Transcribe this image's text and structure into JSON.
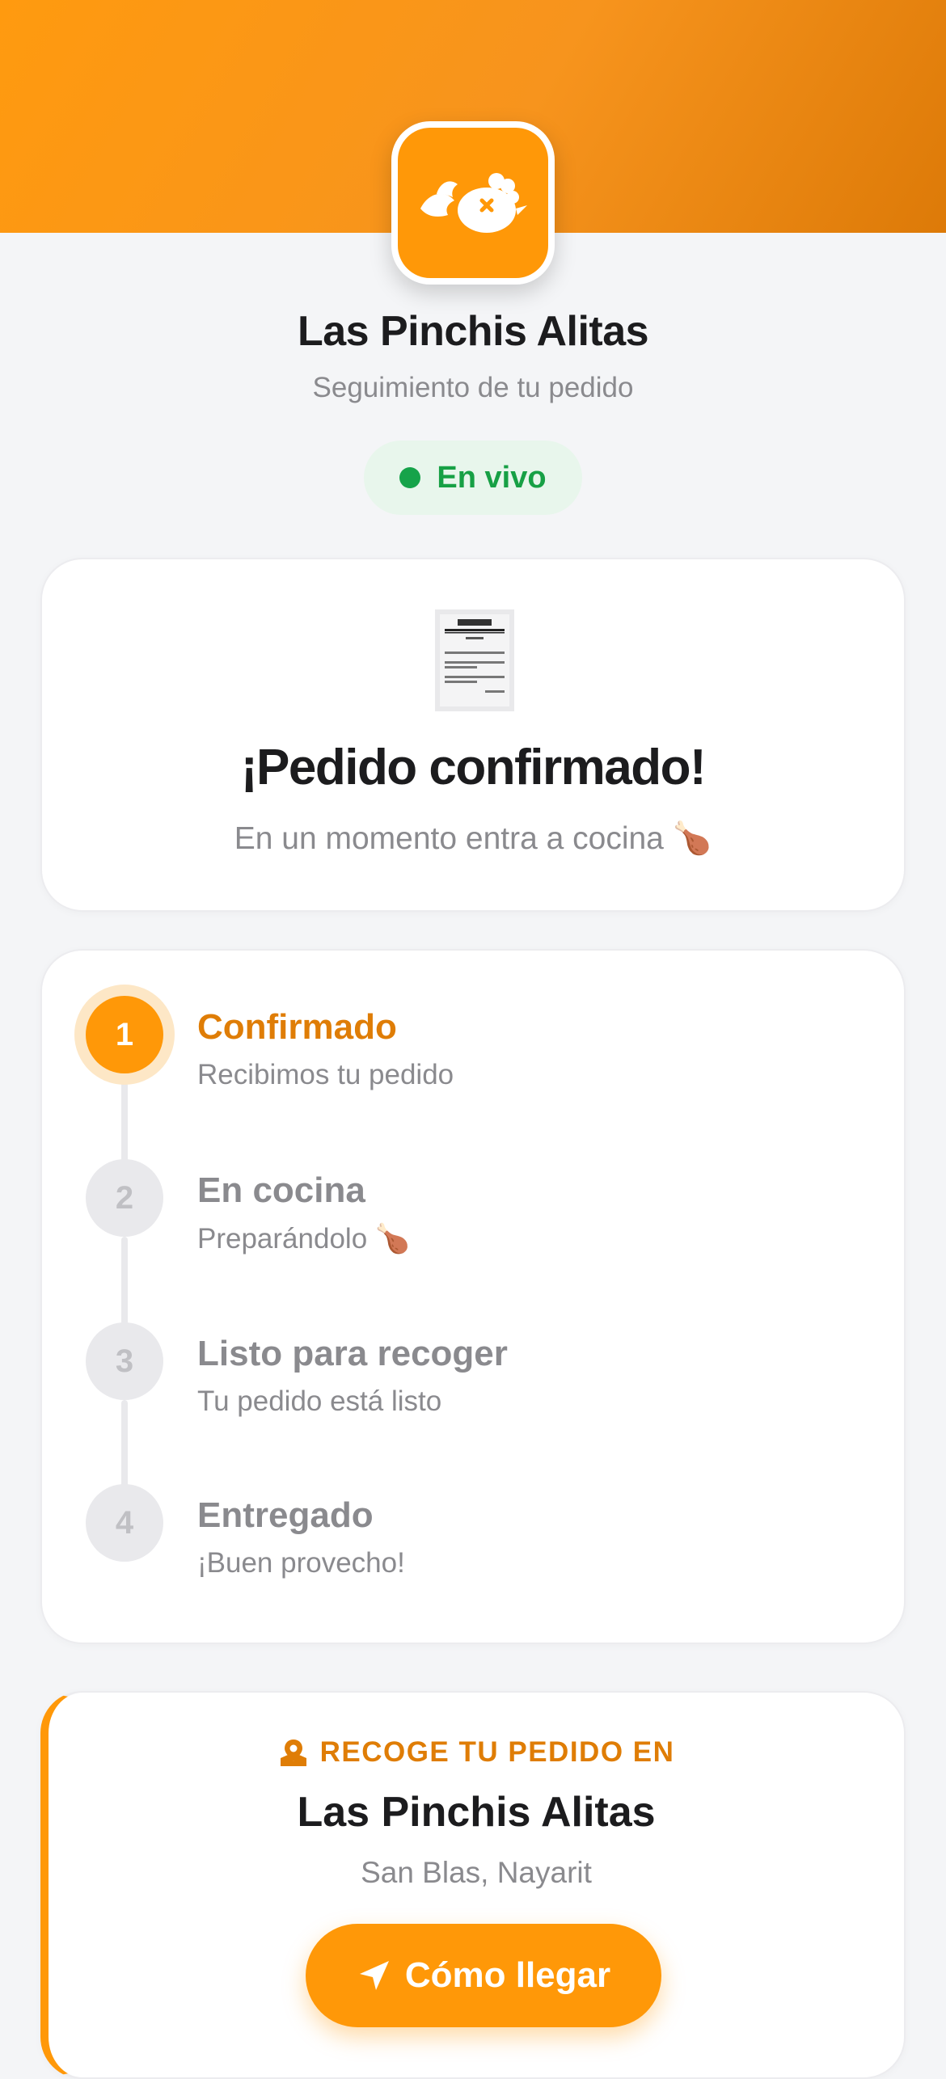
{
  "brand": {
    "name": "Las Pinchis Alitas",
    "subtitle": "Seguimiento de tu pedido",
    "logo_icon": "chicken-logo-icon",
    "accent_color": "#ff9808"
  },
  "live": {
    "label": "En vivo",
    "color": "#16a34a"
  },
  "confirmation": {
    "icon": "receipt-icon",
    "title": "¡Pedido confirmado!",
    "subtitle": "En un momento entra a cocina 🍗"
  },
  "steps": [
    {
      "number": "1",
      "title": "Confirmado",
      "description": "Recibimos tu pedido",
      "active": true
    },
    {
      "number": "2",
      "title": "En cocina",
      "description": "Preparándolo 🍗",
      "active": false
    },
    {
      "number": "3",
      "title": "Listo para recoger",
      "description": "Tu pedido está listo",
      "active": false
    },
    {
      "number": "4",
      "title": "Entregado",
      "description": "¡Buen provecho!",
      "active": false
    }
  ],
  "pickup": {
    "icon": "map-pin-icon",
    "label": "RECOGE TU PEDIDO EN",
    "name": "Las Pinchis Alitas",
    "location": "San Blas, Nayarit",
    "button_icon": "navigation-arrow-icon",
    "button_label": "Cómo llegar"
  }
}
